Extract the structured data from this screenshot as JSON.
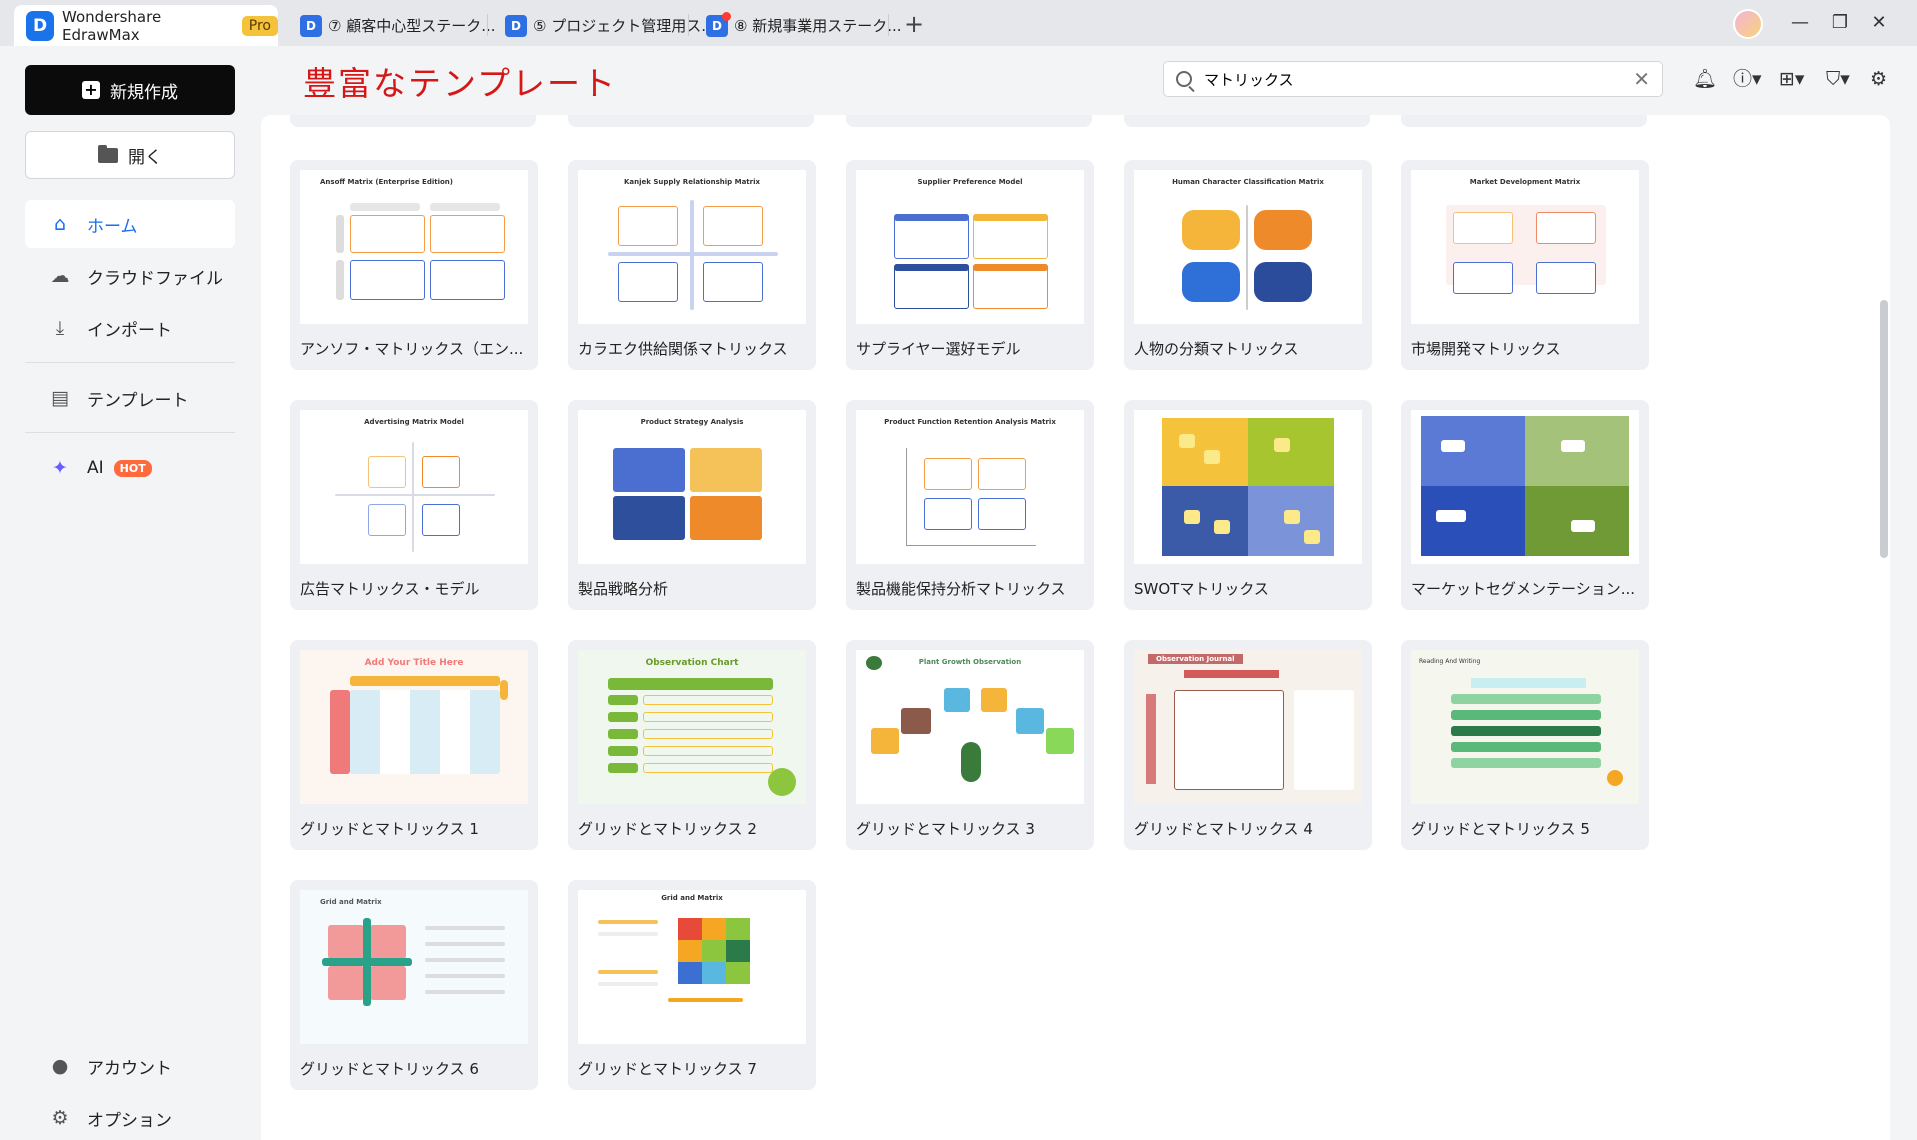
{
  "app": {
    "name": "Wondershare EdrawMax",
    "badge": "Pro",
    "logo": "D"
  },
  "tabs": [
    {
      "label": "⑦ 顧客中心型ステーク..."
    },
    {
      "label": "⑤ プロジェクト管理用ス..."
    },
    {
      "label": "⑧ 新規事業用ステーク..."
    }
  ],
  "sidebar": {
    "new_label": "新規作成",
    "open_label": "開く",
    "items": [
      {
        "label": "ホーム",
        "icon": "home-icon"
      },
      {
        "label": "クラウドファイル",
        "icon": "cloud-icon"
      },
      {
        "label": "インポート",
        "icon": "import-icon"
      },
      {
        "label": "テンプレート",
        "icon": "template-icon"
      },
      {
        "label": "AI",
        "icon": "sparkle-icon",
        "badge": "HOT"
      }
    ],
    "bottom": [
      {
        "label": "アカウント",
        "icon": "account-icon"
      },
      {
        "label": "オプション",
        "icon": "gear-icon"
      }
    ]
  },
  "header": {
    "title": "豊富なテンプレート",
    "search_value": "マトリックス"
  },
  "templates": [
    {
      "label": "アンソフ・マトリックス（エン...",
      "thumb_title": "Ansoff Matrix (Enterprise Edition)"
    },
    {
      "label": "カラエク供給関係マトリックス",
      "thumb_title": "Kanjek Supply Relationship Matrix"
    },
    {
      "label": "サプライヤー選好モデル",
      "thumb_title": "Supplier Preference Model"
    },
    {
      "label": "人物の分類マトリックス",
      "thumb_title": "Human Character Classification Matrix"
    },
    {
      "label": "市場開発マトリックス",
      "thumb_title": "Market Development Matrix"
    },
    {
      "label": "広告マトリックス・モデル",
      "thumb_title": "Advertising Matrix Model"
    },
    {
      "label": "製品戦略分析",
      "thumb_title": "Product Strategy Analysis"
    },
    {
      "label": "製品機能保持分析マトリックス",
      "thumb_title": "Product Function Retention Analysis Matrix"
    },
    {
      "label": "SWOTマトリックス",
      "thumb_title": ""
    },
    {
      "label": "マーケットセグメンテーション...",
      "thumb_title": ""
    },
    {
      "label": "グリッドとマトリックス 1",
      "thumb_title": "Add Your Title Here"
    },
    {
      "label": "グリッドとマトリックス 2",
      "thumb_title": "Observation Chart"
    },
    {
      "label": "グリッドとマトリックス 3",
      "thumb_title": "Plant Growth Observation"
    },
    {
      "label": "グリッドとマトリックス 4",
      "thumb_title": "Observation Journal"
    },
    {
      "label": "グリッドとマトリックス 5",
      "thumb_title": "Reading And Writing"
    },
    {
      "label": "グリッドとマトリックス 6",
      "thumb_title": "Grid and Matrix"
    },
    {
      "label": "グリッドとマトリックス 7",
      "thumb_title": "Grid and Matrix"
    }
  ],
  "colors": {
    "accent": "#1a6ff0",
    "title_red": "#d41818",
    "new_button": "#0b0b0b"
  }
}
